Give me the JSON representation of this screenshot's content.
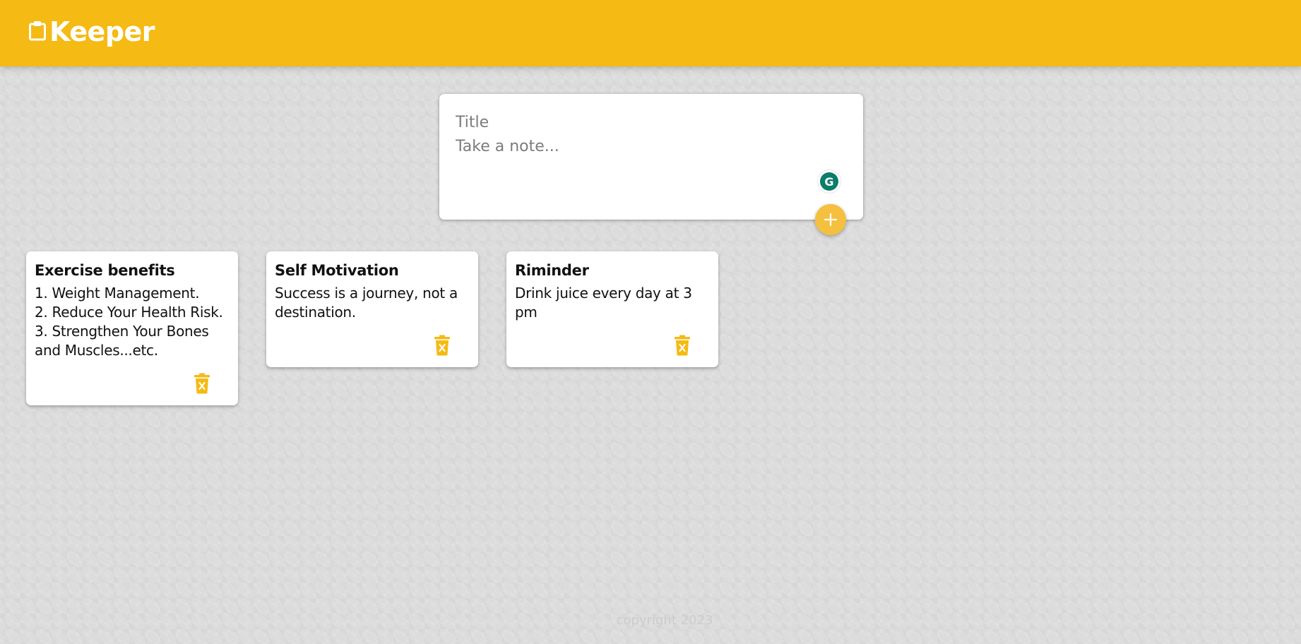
{
  "app": {
    "title": "Keeper"
  },
  "create_note": {
    "title_placeholder": "Title",
    "content_placeholder": "Take a note...",
    "add_button_icon": "plus-icon",
    "grammarly_letter": "G"
  },
  "notes": [
    {
      "title": "Exercise benefits",
      "content": "1. Weight Management.\n2. Reduce Your Health Risk.\n3. Strengthen Your Bones and Muscles...etc."
    },
    {
      "title": "Self Motivation",
      "content": "Success is a journey, not a destination."
    },
    {
      "title": "Riminder",
      "content": "Drink juice every day at 3 pm"
    }
  ],
  "footer": {
    "text": "copyright 2023"
  },
  "colors": {
    "header": "#f5ba13",
    "accent": "#f5ba13",
    "add_button": "#f5c040",
    "grammarly": "#0c7d68"
  },
  "icons": {
    "logo": "clipboard-icon",
    "delete": "delete-forever-icon"
  }
}
